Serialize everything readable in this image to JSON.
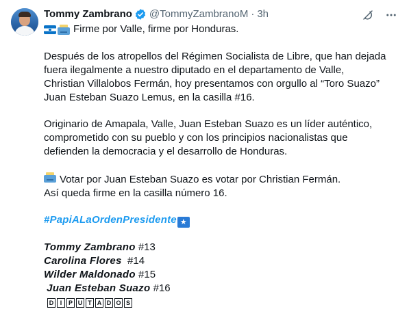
{
  "author": {
    "name": "Tommy Zambrano",
    "handle": "@TommyZambranoM",
    "separator": "·",
    "time": "3h"
  },
  "icons": {
    "verified": "verified-badge-icon",
    "grok": "grok-icon",
    "more": "more-icon",
    "flag": "honduras-flag-icon",
    "ballot": "ballot-box-icon",
    "star": "star-icon"
  },
  "colors": {
    "accent": "#1d9bf0",
    "muted": "#536471",
    "text": "#0f1419"
  },
  "tweet": {
    "intro": "Firme por Valle, firme por Honduras.",
    "p1": [
      "Después de los atropellos del Régimen Socialista de Libre, que han dejada",
      "fuera ilegalmente a nuestro diputado en el departamento de Valle,",
      "Christian Villalobos Fermán, hoy presentamos con orgullo al “Toro Suazo”",
      "Juan Esteban Suazo Lemus, en la casilla #16."
    ],
    "p2": [
      "Originario de Amapala, Valle, Juan Esteban Suazo es un líder auténtico,",
      "comprometido con su pueblo y con los principios nacionalistas que",
      "defienden la democracia y el desarrollo de Honduras."
    ],
    "p3_line1": "Votar por Juan Esteban Suazo es votar por Christian Fermán.",
    "p3_line2": "Así queda firme en la casilla número 16.",
    "hashtag": "#PapiALaOrdenPresidente",
    "star_glyph": "★",
    "candidates": [
      {
        "name": "Tommy Zambrano",
        "number": "#13"
      },
      {
        "name": "Carolina Flores",
        "number": "#14"
      },
      {
        "name": "Wilder Maldonado",
        "number": "#15"
      },
      {
        "name": "Juan Esteban Suazo",
        "number": "#16"
      }
    ],
    "footer_letters": [
      "D",
      "I",
      "P",
      "U",
      "T",
      "A",
      "D",
      "O",
      "S"
    ]
  }
}
